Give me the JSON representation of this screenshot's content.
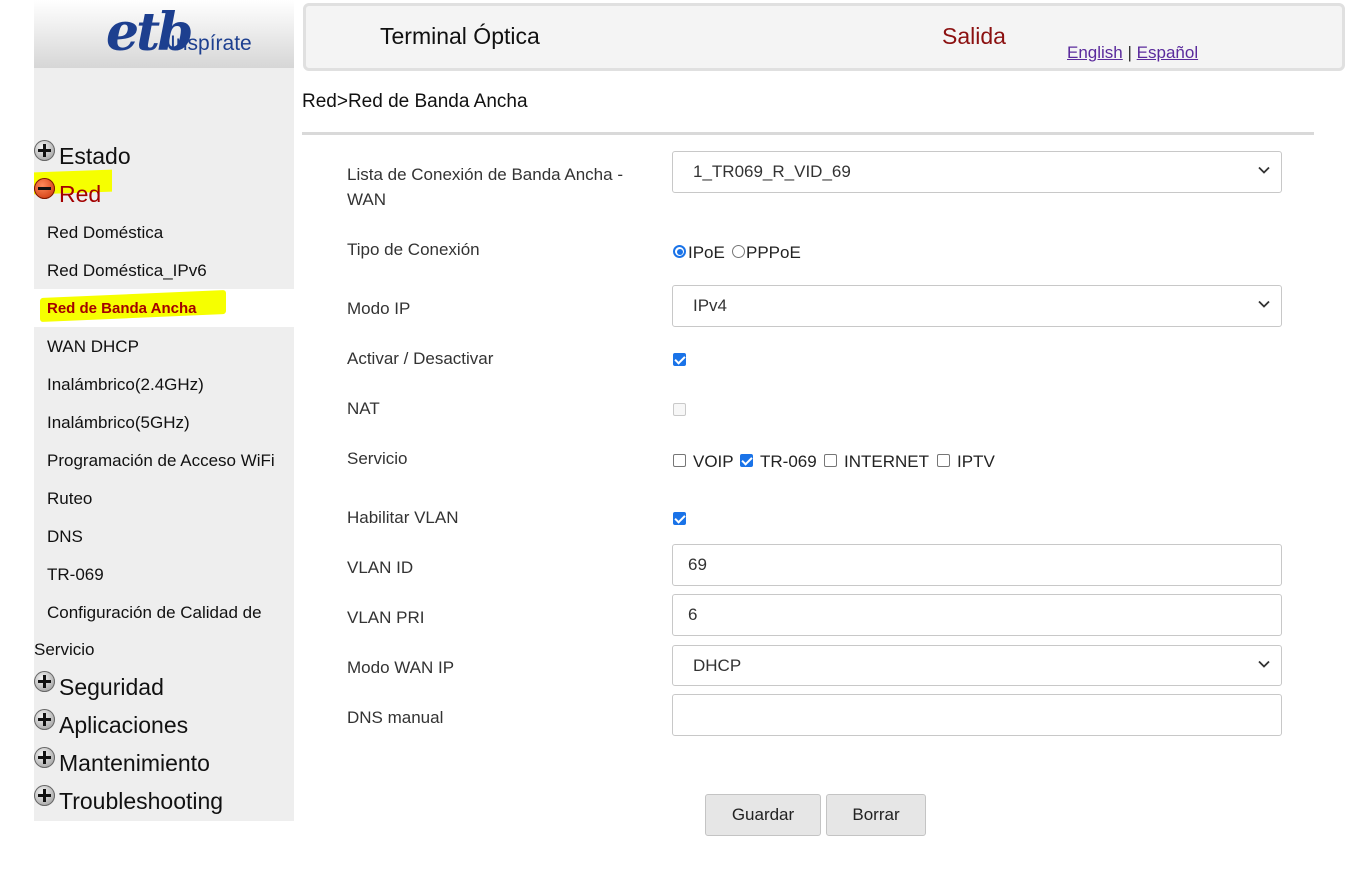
{
  "logo": {
    "brand": "etb",
    "tagline": "Inspírate"
  },
  "header": {
    "title": "Terminal Óptica",
    "exit": "Salida",
    "lang_en": "English",
    "lang_sep": "|",
    "lang_es": "Español"
  },
  "sidebar": {
    "groups": {
      "estado": "Estado",
      "red": "Red",
      "seguridad": "Seguridad",
      "aplicaciones": "Aplicaciones",
      "mantenimiento": "Mantenimiento",
      "troubleshooting": "Troubleshooting"
    },
    "red_items": [
      "Red Doméstica",
      "Red Doméstica_IPv6",
      "Red de Banda Ancha",
      "WAN DHCP",
      "Inalámbrico(2.4GHz)",
      "Inalámbrico(5GHz)",
      "Programación de Acceso WiFi",
      "Ruteo",
      "DNS",
      "TR-069",
      "Configuración de Calidad de",
      "Servicio"
    ]
  },
  "breadcrumb": "Red>Red de Banda Ancha",
  "form": {
    "wan_list_label_line1": "Lista de Conexión de Banda Ancha -",
    "wan_list_label_line2": "WAN",
    "wan_list_value": "1_TR069_R_VID_69",
    "conn_type_label": "Tipo de Conexión",
    "conn_type_options": [
      "IPoE",
      "PPPoE"
    ],
    "conn_type_selected": "IPoE",
    "ip_mode_label": "Modo IP",
    "ip_mode_value": "IPv4",
    "enable_label": "Activar / Desactivar",
    "enable_checked": true,
    "nat_label": "NAT",
    "nat_checked": false,
    "service_label": "Servicio",
    "services": [
      {
        "name": "VOIP",
        "checked": false
      },
      {
        "name": "TR-069",
        "checked": true
      },
      {
        "name": "INTERNET",
        "checked": false
      },
      {
        "name": "IPTV",
        "checked": false
      }
    ],
    "vlan_enable_label": "Habilitar VLAN",
    "vlan_enable_checked": true,
    "vlan_id_label": "VLAN ID",
    "vlan_id_value": "69",
    "vlan_pri_label": "VLAN PRI",
    "vlan_pri_value": "6",
    "wan_ip_mode_label": "Modo WAN IP",
    "wan_ip_mode_value": "DHCP",
    "dns_manual_label": "DNS manual",
    "dns_manual_value": ""
  },
  "buttons": {
    "save": "Guardar",
    "clear": "Borrar"
  },
  "colors": {
    "accent_red": "#a30000",
    "highlight": "#f6ff00",
    "checkbox_blue": "#1a73e8"
  }
}
